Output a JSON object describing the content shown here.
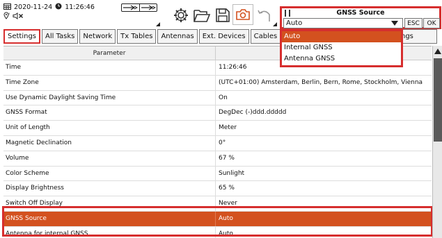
{
  "status": {
    "date": "2020-11-24",
    "time": "11:26:46",
    "icons": [
      "calendar-icon",
      "clock-icon",
      "gps-icon",
      "speaker-muted-icon",
      "battery-icon"
    ]
  },
  "toolbar": {
    "icons": [
      "settings-gear-icon",
      "open-folder-icon",
      "save-icon",
      "camera-icon",
      "undo-icon"
    ]
  },
  "tabs": [
    "Settings",
    "All Tasks",
    "Network",
    "Tx Tables",
    "Antennas",
    "Ext. Devices",
    "Cables"
  ],
  "tab_partial_right": "ngs",
  "table": {
    "header": "Parameter",
    "rows": [
      {
        "param": "Time",
        "value": "11:26:46"
      },
      {
        "param": "Time Zone",
        "value": "(UTC+01:00) Amsterdam, Berlin, Bern, Rome, Stockholm, Vienna"
      },
      {
        "param": "Use Dynamic Daylight Saving Time",
        "value": "On"
      },
      {
        "param": "GNSS Format",
        "value": "DegDec (-)ddd.ddddd"
      },
      {
        "param": "Unit of Length",
        "value": "Meter"
      },
      {
        "param": "Magnetic Declination",
        "value": "0°"
      },
      {
        "param": "Volume",
        "value": "67 %"
      },
      {
        "param": "Color Scheme",
        "value": "Sunlight"
      },
      {
        "param": "Display Brightness",
        "value": "65 %"
      },
      {
        "param": "Switch Off Display",
        "value": "Never"
      },
      {
        "param": "GNSS Source",
        "value": "Auto"
      },
      {
        "param": "Antenna for internal GNSS",
        "value": "Auto"
      }
    ]
  },
  "popup": {
    "title": "GNSS Source",
    "selected": "Auto",
    "esc_label": "ESC",
    "ok_label": "OK",
    "options": [
      "Auto",
      "Internal GNSS",
      "Antenna GNSS"
    ]
  },
  "colors": {
    "accent": "#d3511f",
    "highlight_border": "#d62e2e"
  }
}
